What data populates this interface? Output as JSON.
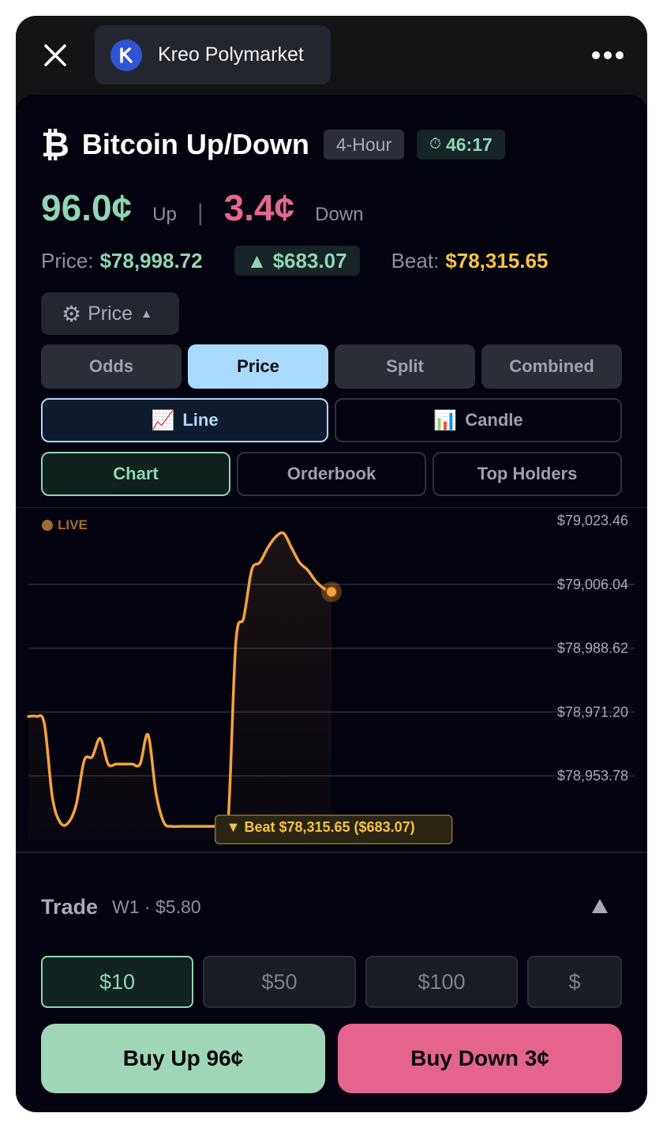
{
  "app": {
    "title": "Kreo Polymarket"
  },
  "market": {
    "symbol_icon": "bitcoin-icon",
    "title": "Bitcoin Up/Down",
    "interval": "4-Hour",
    "timer_icon": "stopwatch-icon",
    "timer": "46:17",
    "up_odds": "96.0¢",
    "up_label": "Up",
    "separator": "|",
    "down_odds": "3.4¢",
    "down_label": "Down",
    "price_label": "Price:",
    "price_value": "$78,998.72",
    "delta": "▲ $683.07",
    "beat_label": "Beat:",
    "beat_value": "$78,315.65"
  },
  "controls": {
    "price_toggle_label": "Price",
    "mode_tabs": [
      {
        "label": "Odds",
        "active": false
      },
      {
        "label": "Price",
        "active": true
      },
      {
        "label": "Split",
        "active": false
      },
      {
        "label": "Combined",
        "active": false
      }
    ],
    "style_tabs": [
      {
        "label": "Line",
        "icon": "📈",
        "active": true
      },
      {
        "label": "Candle",
        "icon": "📊",
        "active": false
      }
    ],
    "view_tabs": [
      {
        "label": "Chart",
        "active": true
      },
      {
        "label": "Orderbook",
        "active": false
      },
      {
        "label": "Top Holders",
        "active": false
      }
    ]
  },
  "chart": {
    "live_label": "LIVE",
    "beat_marker": "▼ Beat $78,315.65 ($683.07)"
  },
  "chart_data": {
    "type": "line",
    "ylim": [
      78936.36,
      79023.46
    ],
    "y_ticks": [
      "$79,023.46",
      "$79,006.04",
      "$78,988.62",
      "$78,971.20",
      "$78,953.78"
    ],
    "y_tick_values": [
      79023.46,
      79006.04,
      78988.62,
      78971.2,
      78953.78
    ],
    "grid": true,
    "series": [
      {
        "color": "#f5a23e",
        "x": [
          0,
          1,
          2,
          3,
          4,
          5,
          6,
          7,
          8,
          9,
          10,
          11,
          12,
          13,
          14,
          15,
          16,
          17,
          18,
          19,
          20,
          21,
          22,
          23,
          24,
          25,
          26,
          27,
          28,
          29,
          30,
          31,
          32,
          33,
          34,
          35,
          36,
          37,
          38
        ],
        "values": [
          78970.0,
          78970.0,
          78968.0,
          78948.0,
          78941.0,
          78941.0,
          78946.0,
          78958.0,
          78959.0,
          78964.0,
          78957.0,
          78957.0,
          78957.0,
          78957.0,
          78957.0,
          78965.0,
          78949.0,
          78941.0,
          78940.0,
          78940.0,
          78940.0,
          78940.0,
          78940.0,
          78940.0,
          78940.0,
          78940.0,
          78990.0,
          78997.0,
          79010.0,
          79012.0,
          79016.0,
          79019.0,
          79020.0,
          79016.0,
          79012.0,
          79010.0,
          79007.0,
          79005.0,
          79004.0
        ]
      }
    ],
    "annotations": [
      {
        "text": "LIVE"
      },
      {
        "text": "▼ Beat $78,315.65 ($683.07)"
      }
    ]
  },
  "trade": {
    "label": "Trade",
    "sub": "W1 · $5.80",
    "amounts": [
      {
        "label": "$10",
        "active": true
      },
      {
        "label": "$50",
        "active": false
      },
      {
        "label": "$100",
        "active": false
      },
      {
        "label": "$",
        "active": false
      }
    ],
    "buy_up": "Buy Up 96¢",
    "buy_down": "Buy Down 3¢"
  },
  "colors": {
    "up": "#8fd6b2",
    "down": "#e5688f",
    "beat": "#f6c344",
    "line": "#f5a23e",
    "active_tab": "#a9dafb"
  }
}
